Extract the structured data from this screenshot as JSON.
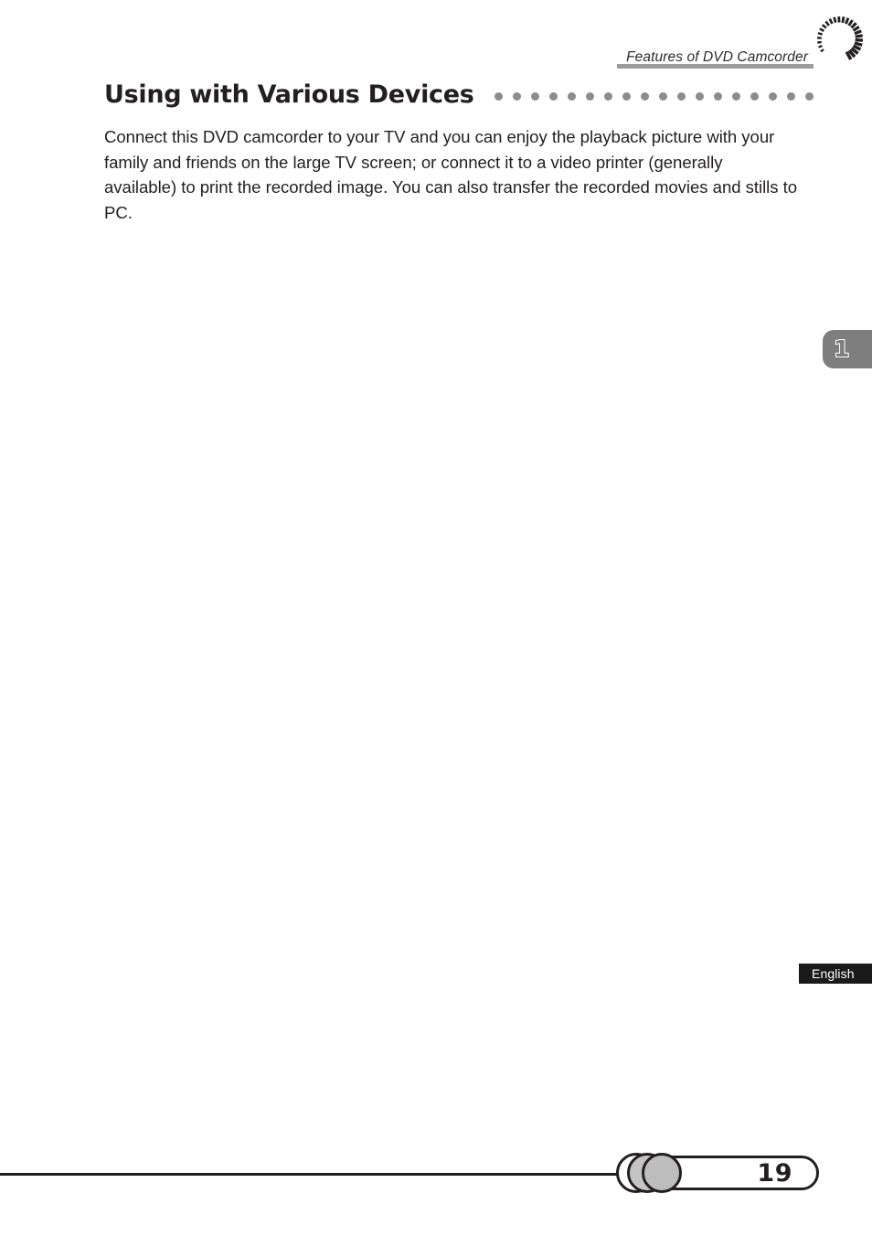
{
  "document": {
    "running_header": "Features of DVD Camcorder",
    "section_title": "Using with Various Devices",
    "title_dot_count": 18,
    "body_paragraph": "Connect this DVD camcorder to your TV and you can enjoy the playback picture with your family and friends on the large TV screen; or connect it to a video printer (generally available) to print the recorded image. You can also transfer the recorded movies and stills to PC.",
    "chapter_number": "1",
    "language_label": "English",
    "page_number": "19"
  },
  "ornaments": {
    "swirl_icon": "comet-swirl-icon",
    "swirl_tick_count": 24
  },
  "colors": {
    "text": "#231f20",
    "rule_gray": "#9c9c9c",
    "dot_gray": "#8c8c8c",
    "chapter_tab_gray": "#7e7e7e",
    "banner_black": "#1a1a1a",
    "circle_gray": "#bdbdbd"
  }
}
